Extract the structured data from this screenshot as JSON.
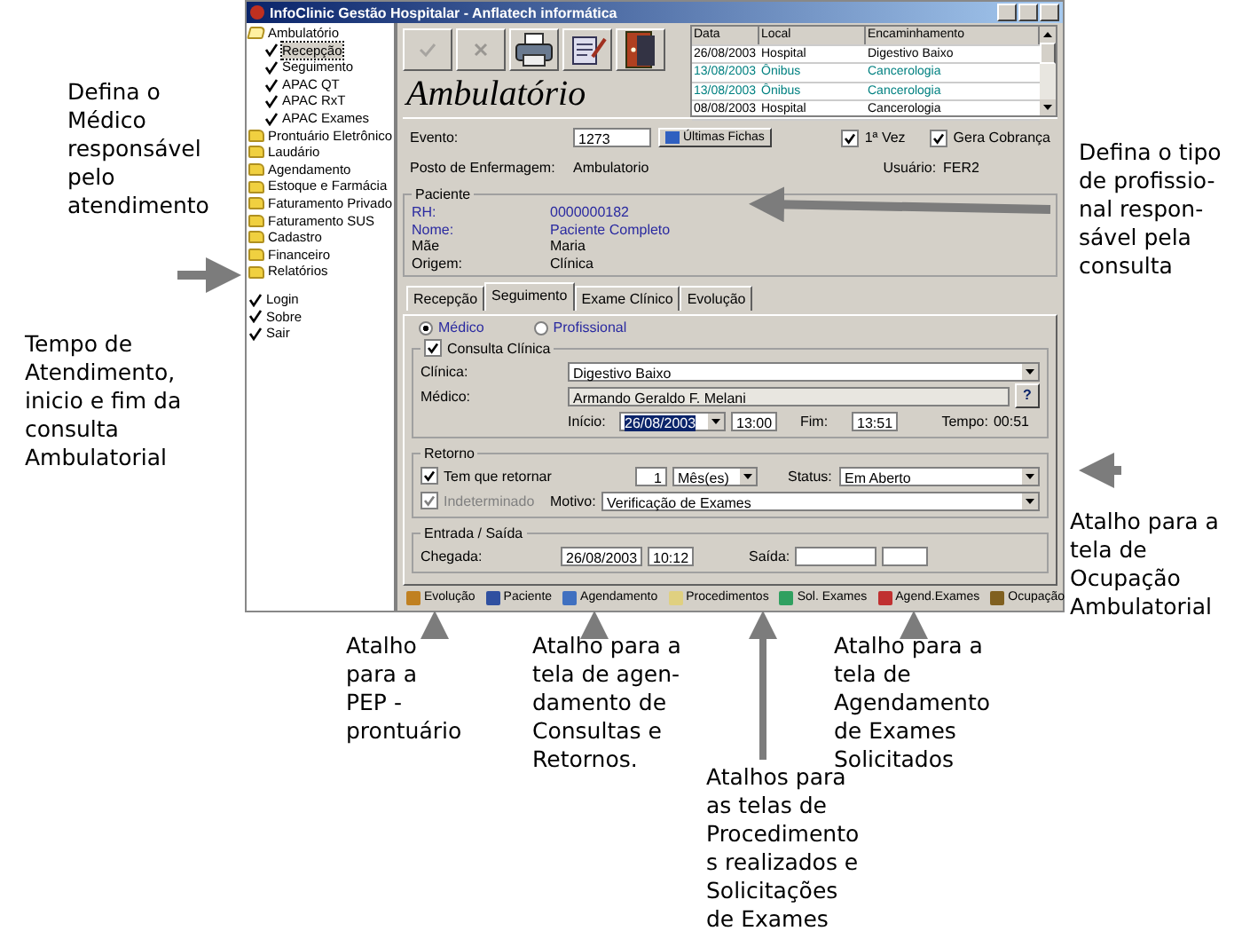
{
  "window": {
    "title": "InfoClinic Gestão Hospitalar - Anflatech informática"
  },
  "sidebar": {
    "items": [
      {
        "label": "Ambulatório",
        "kind": "folder",
        "expanded": true,
        "children": [
          {
            "label": "Recepção",
            "kind": "check",
            "selected": true
          },
          {
            "label": "Seguimento",
            "kind": "check",
            "selected": false
          },
          {
            "label": "APAC QT",
            "kind": "check",
            "selected": false
          },
          {
            "label": "APAC RxT",
            "kind": "check",
            "selected": false
          },
          {
            "label": "APAC Exames",
            "kind": "check",
            "selected": false
          }
        ]
      },
      {
        "label": "Prontuário Eletrônico",
        "kind": "folder"
      },
      {
        "label": "Laudário",
        "kind": "folder"
      },
      {
        "label": "Agendamento",
        "kind": "folder"
      },
      {
        "label": "Estoque e Farmácia",
        "kind": "folder"
      },
      {
        "label": "Faturamento Privado",
        "kind": "folder"
      },
      {
        "label": "Faturamento SUS",
        "kind": "folder"
      },
      {
        "label": "Cadastro",
        "kind": "folder"
      },
      {
        "label": "Financeiro",
        "kind": "folder"
      },
      {
        "label": "Relatórios",
        "kind": "folder"
      }
    ],
    "bottom_items": [
      {
        "label": "Login"
      },
      {
        "label": "Sobre"
      },
      {
        "label": "Sair"
      }
    ]
  },
  "toolbar": [
    {
      "kind": "confirm",
      "disabled": true
    },
    {
      "kind": "cancel",
      "disabled": true
    },
    {
      "kind": "printer",
      "disabled": false
    },
    {
      "kind": "notes",
      "disabled": false
    },
    {
      "kind": "exit",
      "disabled": false
    }
  ],
  "heading": "Ambulatório",
  "history": {
    "columns": [
      "Data",
      "Local",
      "Encaminhamento"
    ],
    "rows": [
      {
        "cells": [
          "26/08/2003",
          "Hospital",
          "Digestivo Baixo"
        ],
        "color": "#000000"
      },
      {
        "cells": [
          "13/08/2003",
          "Ônibus",
          "Cancerologia"
        ],
        "color": "#008080"
      },
      {
        "cells": [
          "13/08/2003",
          "Ônibus",
          "Cancerologia"
        ],
        "color": "#008080"
      },
      {
        "cells": [
          "08/08/2003",
          "Hospital",
          "Cancerologia"
        ],
        "color": "#000000"
      }
    ]
  },
  "evento": {
    "label": "Evento:",
    "value": "1273",
    "button": "Últimas Fichas",
    "checks": [
      {
        "label": "1ª Vez",
        "checked": true
      },
      {
        "label": "Gera Cobrança",
        "checked": true
      }
    ],
    "posto_label": "Posto de Enfermagem:",
    "posto": "Ambulatorio",
    "usuario_label": "Usuário:",
    "usuario": "FER2"
  },
  "paciente": {
    "title": "Paciente",
    "fields": [
      {
        "label": "RH:",
        "value": "0000000182",
        "highlight": true
      },
      {
        "label": "Nome:",
        "value": "Paciente Completo",
        "highlight": true
      },
      {
        "label": "Mãe",
        "value": "Maria",
        "highlight": false
      },
      {
        "label": "Origem:",
        "value": "Clínica",
        "highlight": false
      }
    ]
  },
  "tabs": [
    {
      "label": "Recepção",
      "selected": false
    },
    {
      "label": "Seguimento",
      "selected": true
    },
    {
      "label": "Exame Clínico",
      "selected": false
    },
    {
      "label": "Evolução",
      "selected": false
    }
  ],
  "radios": [
    {
      "label": "Médico",
      "selected": true
    },
    {
      "label": "Profissional",
      "selected": false
    }
  ],
  "consulta": {
    "label": "Consulta Clínica",
    "checked": true,
    "clinica_label": "Clínica:",
    "clinica": "Digestivo Baixo",
    "medico_label": "Médico:",
    "medico": "Armando Geraldo F. Melani",
    "help": "?",
    "inicio_label": "Início:",
    "inicio_data": "26/08/2003",
    "inicio_hora": "13:00",
    "fim_label": "Fim:",
    "fim": "13:51",
    "tempo_label": "Tempo:",
    "tempo": "00:51"
  },
  "retorno": {
    "title": "Retorno",
    "retornar_label": "Tem que retornar",
    "retornar": true,
    "qtd": "1",
    "unidade": "Mês(es)",
    "status_label": "Status:",
    "status": "Em Aberto",
    "indeterminado_label": "Indeterminado",
    "indeterminado": true,
    "motivo_label": "Motivo:",
    "motivo": "Verificação de Exames"
  },
  "entrada": {
    "title": "Entrada / Saída",
    "chegada_label": "Chegada:",
    "chegada_data": "26/08/2003",
    "chegada_hora": "10:12",
    "saida_label": "Saída:"
  },
  "shortcuts": [
    {
      "label": "Evolução",
      "kind": "evolucao"
    },
    {
      "label": "Paciente",
      "kind": "paciente"
    },
    {
      "label": "Agendamento",
      "kind": "agenda"
    },
    {
      "label": "Procedimentos",
      "kind": "proc"
    },
    {
      "label": "Sol. Exames",
      "kind": "exames"
    },
    {
      "label": "Agend.Exames",
      "kind": "agendex"
    },
    {
      "label": "Ocupação",
      "kind": "ocupacao"
    }
  ],
  "annotations": [
    {
      "kind": "medico",
      "lines": [
        "Defina o",
        "Médico",
        "responsável",
        "pelo",
        "atendimento"
      ]
    },
    {
      "kind": "tempo",
      "lines": [
        "Tempo de",
        "Atendimento,",
        "inicio e fim da",
        "consulta",
        "Ambulatorial"
      ]
    },
    {
      "kind": "tipo",
      "lines": [
        "Defina o tipo",
        "de profissio-",
        "nal respon-",
        "sável pela",
        "consulta"
      ]
    },
    {
      "kind": "ocupacao",
      "lines": [
        "Atalho para a",
        "tela de",
        "Ocupação",
        "Ambulatorial"
      ]
    },
    {
      "kind": "pep",
      "lines": [
        "Atalho",
        "para a",
        "PEP -",
        "prontuário"
      ]
    },
    {
      "kind": "agenda",
      "lines": [
        "Atalho para a",
        "tela de agen-",
        "damento de",
        "Consultas e",
        "Retornos."
      ]
    },
    {
      "kind": "procs",
      "lines": [
        "Atalhos para",
        "as telas de",
        "Procedimento",
        "s realizados e",
        "Solicitações",
        "de Exames"
      ]
    },
    {
      "kind": "agendex",
      "lines": [
        "Atalho para a",
        "tela de",
        "Agendamento",
        "de Exames",
        "Solicitados"
      ]
    }
  ]
}
